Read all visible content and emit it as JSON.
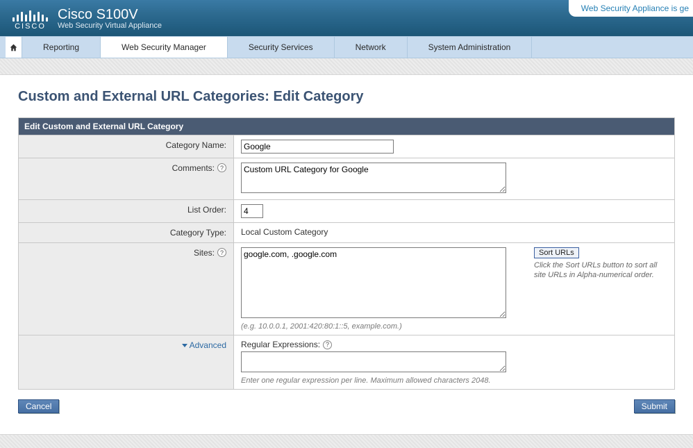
{
  "brand": {
    "product": "Cisco S100V",
    "sub": "Web Security Virtual Appliance",
    "logo_word": "CISCO"
  },
  "status_bar": "Web Security Appliance is ge",
  "nav": {
    "items": [
      "Reporting",
      "Web Security Manager",
      "Security Services",
      "Network",
      "System Administration"
    ],
    "active_index": 1
  },
  "page_title": "Custom and External URL Categories: Edit Category",
  "panel_title": "Edit Custom and External URL Category",
  "fields": {
    "category_name": {
      "label": "Category Name:",
      "value": "Google"
    },
    "comments": {
      "label": "Comments:",
      "value": "Custom URL Category for Google"
    },
    "list_order": {
      "label": "List Order:",
      "value": "4"
    },
    "category_type": {
      "label": "Category Type:",
      "value": "Local Custom Category"
    },
    "sites": {
      "label": "Sites:",
      "value": "google.com, .google.com",
      "hint": "(e.g. 10.0.0.1, 2001:420:80:1::5, example.com.)",
      "sort_button": "Sort URLs",
      "sort_help": "Click the Sort URLs button to sort all site URLs in Alpha-numerical order."
    },
    "advanced": {
      "toggle": "Advanced",
      "regex_label": "Regular Expressions:",
      "value": "",
      "hint": "Enter one regular expression per line. Maximum allowed characters 2048."
    }
  },
  "buttons": {
    "cancel": "Cancel",
    "submit": "Submit"
  }
}
